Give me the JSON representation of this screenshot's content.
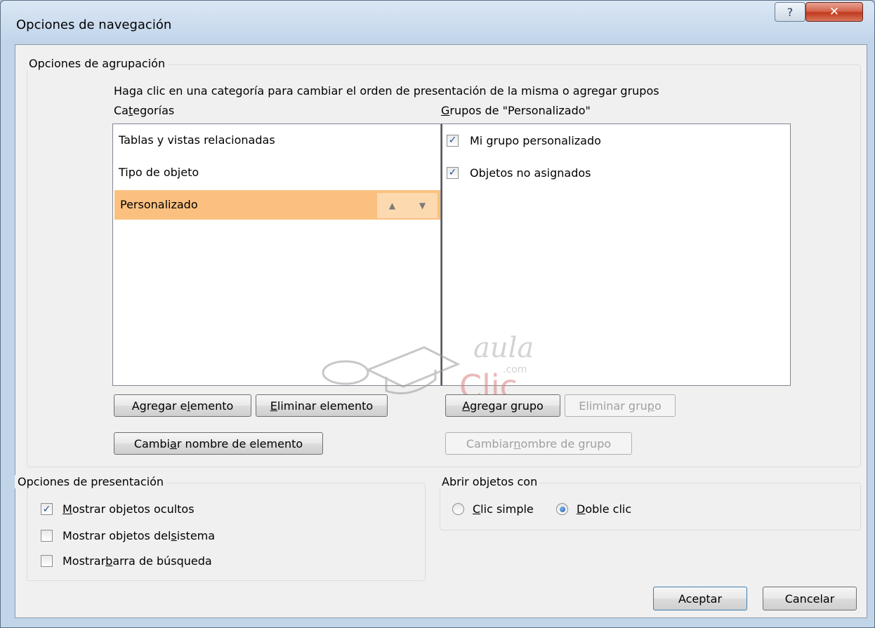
{
  "window": {
    "title": "Opciones de navegación",
    "help_icon": "question-mark",
    "close_icon": "close-x"
  },
  "grouping": {
    "label": "Opciones de agrupación",
    "instruction": "Haga clic en una categoría para cambiar el orden de presentación de la misma o agregar grupos",
    "categories_header": {
      "pre": "Ca",
      "mnemonic": "t",
      "post": "egorías"
    },
    "groups_header": {
      "pre": "",
      "mnemonic": "G",
      "post": "rupos de \"Personalizado\""
    },
    "categories": [
      {
        "label": "Tablas y vistas relacionadas",
        "selected": false
      },
      {
        "label": "Tipo de objeto",
        "selected": false
      },
      {
        "label": "Personalizado",
        "selected": true
      }
    ],
    "groups": [
      {
        "label": "Mi grupo personalizado",
        "checked": true
      },
      {
        "label": "Objetos no asignados",
        "checked": true
      }
    ],
    "buttons": {
      "add_item": {
        "pre": "Agregar e",
        "mnemonic": "l",
        "post": "emento"
      },
      "delete_item": {
        "pre": "",
        "mnemonic": "E",
        "post": "liminar elemento"
      },
      "rename_item": {
        "pre": "Cambi",
        "mnemonic": "a",
        "post": "r nombre de elemento"
      },
      "add_group": {
        "pre": "",
        "mnemonic": "A",
        "post": "gregar grupo"
      },
      "delete_group": {
        "pre": "Eliminar gru",
        "mnemonic": "p",
        "post": "o"
      },
      "rename_group": {
        "pre": "Cambiar ",
        "mnemonic": "n",
        "post": "ombre de grupo"
      }
    },
    "selection_color": "#fbc080"
  },
  "watermark": {
    "text_top": "aula",
    "text_mid": ".com",
    "text_bottom": "Clic"
  },
  "display": {
    "label": "Opciones de presentación",
    "options": [
      {
        "pre": "",
        "mnemonic": "M",
        "post": "ostrar objetos ocultos",
        "checked": true
      },
      {
        "pre": "Mostrar objetos del ",
        "mnemonic": "s",
        "post": "istema",
        "checked": false
      },
      {
        "pre": "Mostrar ",
        "mnemonic": "b",
        "post": "arra de búsqueda",
        "checked": false
      }
    ]
  },
  "open_with": {
    "label": "Abrir objetos con",
    "options": [
      {
        "pre": "",
        "mnemonic": "C",
        "post": "lic simple",
        "selected": false
      },
      {
        "pre": "",
        "mnemonic": "D",
        "post": "oble clic",
        "selected": true
      }
    ]
  },
  "footer": {
    "ok_label": "Aceptar",
    "cancel_label": "Cancelar"
  }
}
